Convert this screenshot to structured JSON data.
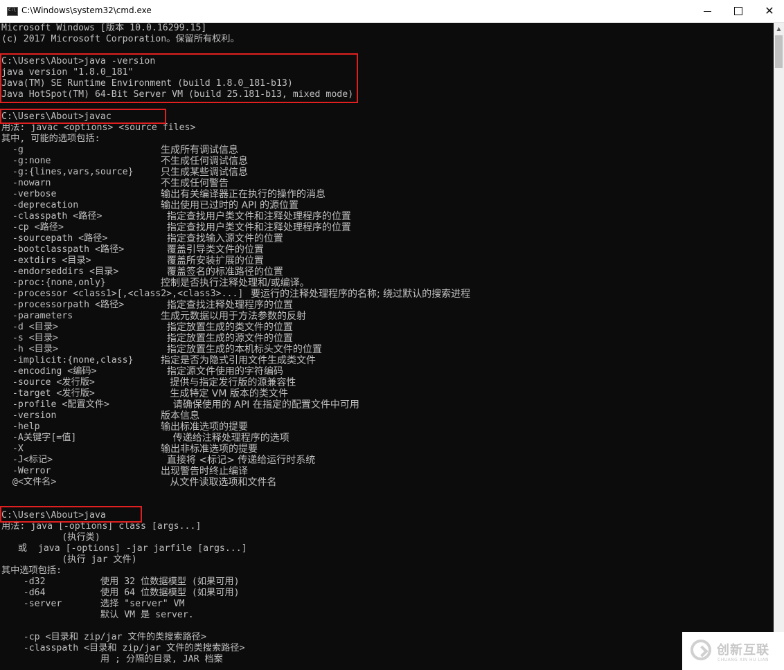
{
  "window": {
    "title": "C:\\Windows\\system32\\cmd.exe",
    "minimize_icon": "minimize-icon",
    "maximize_icon": "maximize-icon",
    "close_icon": "close-icon"
  },
  "console": {
    "lines": [
      "Microsoft Windows [版本 10.0.16299.15]",
      "(c) 2017 Microsoft Corporation。保留所有权利。",
      "",
      "C:\\Users\\About>java -version",
      "java version \"1.8.0_181\"",
      "Java(TM) SE Runtime Environment (build 1.8.0_181-b13)",
      "Java HotSpot(TM) 64-Bit Server VM (build 25.181-b13, mixed mode)",
      "",
      "C:\\Users\\About>javac",
      "用法: javac <options> <source files>",
      "其中, 可能的选项包括:"
    ],
    "javac_options": [
      {
        "opt": "  -g",
        "desc": "生成所有调试信息"
      },
      {
        "opt": "  -g:none",
        "desc": "不生成任何调试信息"
      },
      {
        "opt": "  -g:{lines,vars,source}",
        "desc": "只生成某些调试信息"
      },
      {
        "opt": "  -nowarn",
        "desc": "不生成任何警告"
      },
      {
        "opt": "  -verbose",
        "desc": "输出有关编译器正在执行的操作的消息"
      },
      {
        "opt": "  -deprecation",
        "desc": "输出使用已过时的 API 的源位置"
      },
      {
        "opt": "  -classpath <路径>",
        "desc": "  指定查找用户类文件和注释处理程序的位置"
      },
      {
        "opt": "  -cp <路径>",
        "desc": "  指定查找用户类文件和注释处理程序的位置"
      },
      {
        "opt": "  -sourcepath <路径>",
        "desc": "  指定查找输入源文件的位置"
      },
      {
        "opt": "  -bootclasspath <路径>",
        "desc": "  覆盖引导类文件的位置"
      },
      {
        "opt": "  -extdirs <目录>",
        "desc": "  覆盖所安装扩展的位置"
      },
      {
        "opt": "  -endorseddirs <目录>",
        "desc": "  覆盖签名的标准路径的位置"
      },
      {
        "opt": "  -proc:{none,only}",
        "desc": "控制是否执行注释处理和/或编译。"
      },
      {
        "opt": "  -processor <class1>[,<class2>,<class3>...]",
        "desc": "要运行的注释处理程序的名称; 绕过默认的搜索进程"
      },
      {
        "opt": "  -processorpath <路径>",
        "desc": "  指定查找注释处理程序的位置"
      },
      {
        "opt": "  -parameters",
        "desc": "生成元数据以用于方法参数的反射"
      },
      {
        "opt": "  -d <目录>",
        "desc": "  指定放置生成的类文件的位置"
      },
      {
        "opt": "  -s <目录>",
        "desc": "  指定放置生成的源文件的位置"
      },
      {
        "opt": "  -h <目录>",
        "desc": "  指定放置生成的本机标头文件的位置"
      },
      {
        "opt": "  -implicit:{none,class}",
        "desc": "指定是否为隐式引用文件生成类文件"
      },
      {
        "opt": "  -encoding <编码>",
        "desc": "  指定源文件使用的字符编码"
      },
      {
        "opt": "  -source <发行版>",
        "desc": "   提供与指定发行版的源兼容性"
      },
      {
        "opt": "  -target <发行版>",
        "desc": "   生成特定 VM 版本的类文件"
      },
      {
        "opt": "  -profile <配置文件>",
        "desc": "    请确保使用的 API 在指定的配置文件中可用"
      },
      {
        "opt": "  -version",
        "desc": "版本信息"
      },
      {
        "opt": "  -help",
        "desc": "输出标准选项的提要"
      },
      {
        "opt": "  -A关键字[=值]",
        "desc": "    传递给注释处理程序的选项"
      },
      {
        "opt": "  -X",
        "desc": "输出非标准选项的提要"
      },
      {
        "opt": "  -J<标记>",
        "desc": "  直接将 <标记> 传递给运行时系统"
      },
      {
        "opt": "  -Werror",
        "desc": "出现警告时终止编译"
      },
      {
        "opt": "  @<文件名>",
        "desc": "   从文件读取选项和文件名"
      }
    ],
    "java_prompt": "C:\\Users\\About>java",
    "java_usage": [
      "用法: java [-options] class [args...]",
      "           (执行类)",
      "   或  java [-options] -jar jarfile [args...]",
      "           (执行 jar 文件)",
      "其中选项包括:",
      "    -d32          使用 32 位数据模型 (如果可用)",
      "    -d64          使用 64 位数据模型 (如果可用)",
      "    -server       选择 \"server\" VM",
      "                  默认 VM 是 server.",
      "",
      "    -cp <目录和 zip/jar 文件的类搜索路径>",
      "    -classpath <目录和 zip/jar 文件的类搜索路径>",
      "                  用 ; 分隔的目录, JAR 档案"
    ]
  },
  "highlight_color": "#e02020",
  "watermark": {
    "name": "创新互联",
    "sub": "CHUANG XIN HU LIAN",
    "logo_icon": "chuangxin-logo-icon"
  }
}
